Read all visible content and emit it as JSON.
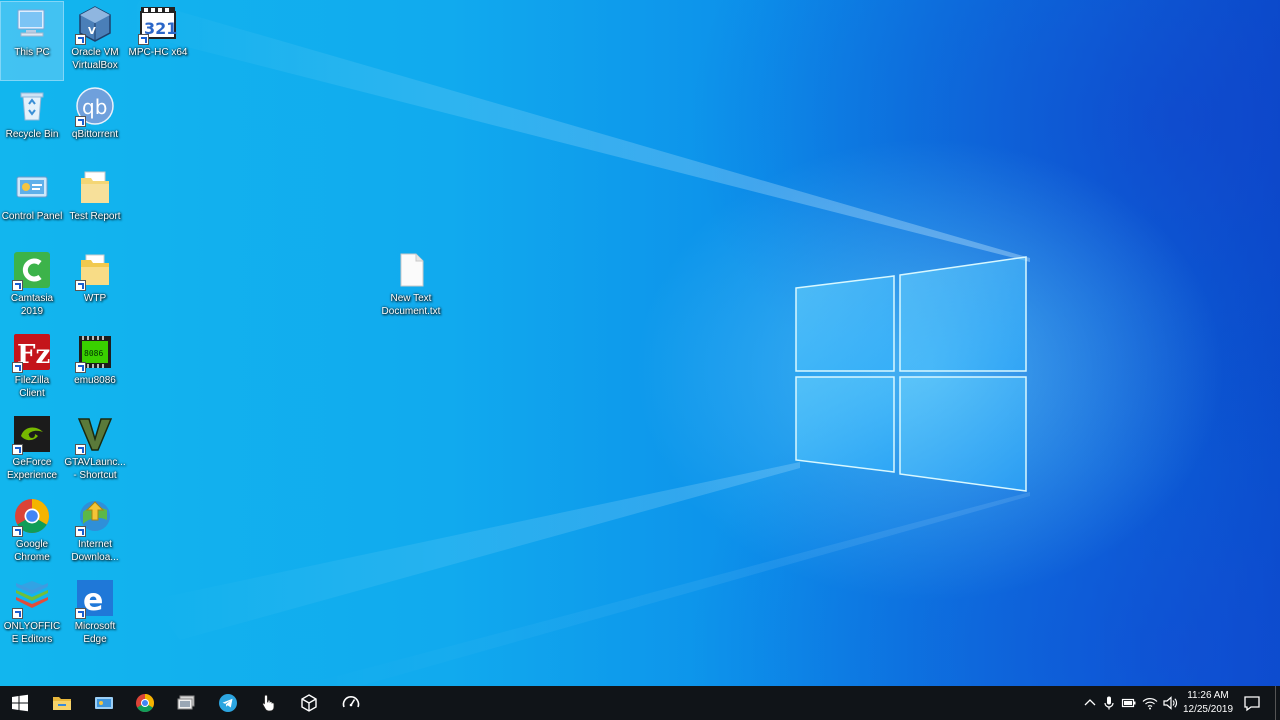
{
  "desktop": {
    "icons": [
      {
        "label": "This PC",
        "icon": "computer-icon"
      },
      {
        "label": "Oracle VM VirtualBox",
        "icon": "virtualbox-icon"
      },
      {
        "label": "MPC-HC x64",
        "icon": "mpc-hc-icon"
      },
      {
        "label": "Recycle Bin",
        "icon": "recycle-bin-icon"
      },
      {
        "label": "qBittorrent",
        "icon": "qbittorrent-icon"
      },
      {
        "label": "Control Panel",
        "icon": "control-panel-icon"
      },
      {
        "label": "Test Report",
        "icon": "folder-documents-icon"
      },
      {
        "label": "Camtasia 2019",
        "icon": "camtasia-icon"
      },
      {
        "label": "WTP",
        "icon": "folder-icon"
      },
      {
        "label": "FileZilla Client",
        "icon": "filezilla-icon"
      },
      {
        "label": "emu8086",
        "icon": "emu8086-icon"
      },
      {
        "label": "GeForce Experience",
        "icon": "geforce-icon"
      },
      {
        "label": "GTAVLaunc... - Shortcut",
        "icon": "gtav-icon"
      },
      {
        "label": "Google Chrome",
        "icon": "chrome-icon"
      },
      {
        "label": "Internet Downloa...",
        "icon": "idm-icon"
      },
      {
        "label": "ONLYOFFICE Editors",
        "icon": "onlyoffice-icon"
      },
      {
        "label": "Microsoft Edge",
        "icon": "edge-icon"
      },
      {
        "label": "New Text Document.txt",
        "icon": "text-file-icon"
      }
    ]
  },
  "taskbar": {
    "start_icon": "windows-start-icon",
    "pinned": [
      {
        "name": "file-explorer",
        "icon": "folder-icon"
      },
      {
        "name": "control-panel",
        "icon": "control-panel-icon"
      },
      {
        "name": "chrome",
        "icon": "chrome-icon"
      },
      {
        "name": "virtual-machine",
        "icon": "vm-icon"
      },
      {
        "name": "telegram",
        "icon": "telegram-icon"
      },
      {
        "name": "pointer-app",
        "icon": "hand-pointer-icon"
      },
      {
        "name": "virtualbox",
        "icon": "cube-icon"
      },
      {
        "name": "speedometer",
        "icon": "speedometer-icon"
      }
    ],
    "tray": {
      "icons": [
        "chevron-up-icon",
        "microphone-icon",
        "battery-icon",
        "wifi-icon",
        "volume-icon"
      ],
      "time": "11:26 AM",
      "date": "12/25/2019",
      "notification_icon": "notification-icon"
    }
  },
  "colors": {
    "taskbar_bg": "#101418",
    "wallpaper_accent": "#12b6ee"
  }
}
